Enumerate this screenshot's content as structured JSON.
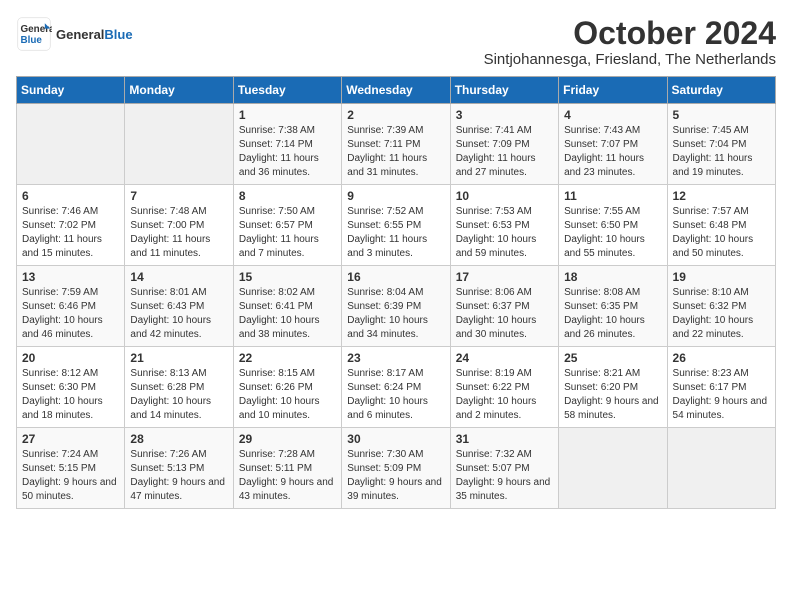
{
  "header": {
    "logo_line1": "General",
    "logo_line2": "Blue",
    "title": "October 2024",
    "subtitle": "Sintjohannesga, Friesland, The Netherlands"
  },
  "weekdays": [
    "Sunday",
    "Monday",
    "Tuesday",
    "Wednesday",
    "Thursday",
    "Friday",
    "Saturday"
  ],
  "weeks": [
    [
      {
        "day": "",
        "info": ""
      },
      {
        "day": "",
        "info": ""
      },
      {
        "day": "1",
        "info": "Sunrise: 7:38 AM\nSunset: 7:14 PM\nDaylight: 11 hours and 36 minutes."
      },
      {
        "day": "2",
        "info": "Sunrise: 7:39 AM\nSunset: 7:11 PM\nDaylight: 11 hours and 31 minutes."
      },
      {
        "day": "3",
        "info": "Sunrise: 7:41 AM\nSunset: 7:09 PM\nDaylight: 11 hours and 27 minutes."
      },
      {
        "day": "4",
        "info": "Sunrise: 7:43 AM\nSunset: 7:07 PM\nDaylight: 11 hours and 23 minutes."
      },
      {
        "day": "5",
        "info": "Sunrise: 7:45 AM\nSunset: 7:04 PM\nDaylight: 11 hours and 19 minutes."
      }
    ],
    [
      {
        "day": "6",
        "info": "Sunrise: 7:46 AM\nSunset: 7:02 PM\nDaylight: 11 hours and 15 minutes."
      },
      {
        "day": "7",
        "info": "Sunrise: 7:48 AM\nSunset: 7:00 PM\nDaylight: 11 hours and 11 minutes."
      },
      {
        "day": "8",
        "info": "Sunrise: 7:50 AM\nSunset: 6:57 PM\nDaylight: 11 hours and 7 minutes."
      },
      {
        "day": "9",
        "info": "Sunrise: 7:52 AM\nSunset: 6:55 PM\nDaylight: 11 hours and 3 minutes."
      },
      {
        "day": "10",
        "info": "Sunrise: 7:53 AM\nSunset: 6:53 PM\nDaylight: 10 hours and 59 minutes."
      },
      {
        "day": "11",
        "info": "Sunrise: 7:55 AM\nSunset: 6:50 PM\nDaylight: 10 hours and 55 minutes."
      },
      {
        "day": "12",
        "info": "Sunrise: 7:57 AM\nSunset: 6:48 PM\nDaylight: 10 hours and 50 minutes."
      }
    ],
    [
      {
        "day": "13",
        "info": "Sunrise: 7:59 AM\nSunset: 6:46 PM\nDaylight: 10 hours and 46 minutes."
      },
      {
        "day": "14",
        "info": "Sunrise: 8:01 AM\nSunset: 6:43 PM\nDaylight: 10 hours and 42 minutes."
      },
      {
        "day": "15",
        "info": "Sunrise: 8:02 AM\nSunset: 6:41 PM\nDaylight: 10 hours and 38 minutes."
      },
      {
        "day": "16",
        "info": "Sunrise: 8:04 AM\nSunset: 6:39 PM\nDaylight: 10 hours and 34 minutes."
      },
      {
        "day": "17",
        "info": "Sunrise: 8:06 AM\nSunset: 6:37 PM\nDaylight: 10 hours and 30 minutes."
      },
      {
        "day": "18",
        "info": "Sunrise: 8:08 AM\nSunset: 6:35 PM\nDaylight: 10 hours and 26 minutes."
      },
      {
        "day": "19",
        "info": "Sunrise: 8:10 AM\nSunset: 6:32 PM\nDaylight: 10 hours and 22 minutes."
      }
    ],
    [
      {
        "day": "20",
        "info": "Sunrise: 8:12 AM\nSunset: 6:30 PM\nDaylight: 10 hours and 18 minutes."
      },
      {
        "day": "21",
        "info": "Sunrise: 8:13 AM\nSunset: 6:28 PM\nDaylight: 10 hours and 14 minutes."
      },
      {
        "day": "22",
        "info": "Sunrise: 8:15 AM\nSunset: 6:26 PM\nDaylight: 10 hours and 10 minutes."
      },
      {
        "day": "23",
        "info": "Sunrise: 8:17 AM\nSunset: 6:24 PM\nDaylight: 10 hours and 6 minutes."
      },
      {
        "day": "24",
        "info": "Sunrise: 8:19 AM\nSunset: 6:22 PM\nDaylight: 10 hours and 2 minutes."
      },
      {
        "day": "25",
        "info": "Sunrise: 8:21 AM\nSunset: 6:20 PM\nDaylight: 9 hours and 58 minutes."
      },
      {
        "day": "26",
        "info": "Sunrise: 8:23 AM\nSunset: 6:17 PM\nDaylight: 9 hours and 54 minutes."
      }
    ],
    [
      {
        "day": "27",
        "info": "Sunrise: 7:24 AM\nSunset: 5:15 PM\nDaylight: 9 hours and 50 minutes."
      },
      {
        "day": "28",
        "info": "Sunrise: 7:26 AM\nSunset: 5:13 PM\nDaylight: 9 hours and 47 minutes."
      },
      {
        "day": "29",
        "info": "Sunrise: 7:28 AM\nSunset: 5:11 PM\nDaylight: 9 hours and 43 minutes."
      },
      {
        "day": "30",
        "info": "Sunrise: 7:30 AM\nSunset: 5:09 PM\nDaylight: 9 hours and 39 minutes."
      },
      {
        "day": "31",
        "info": "Sunrise: 7:32 AM\nSunset: 5:07 PM\nDaylight: 9 hours and 35 minutes."
      },
      {
        "day": "",
        "info": ""
      },
      {
        "day": "",
        "info": ""
      }
    ]
  ]
}
